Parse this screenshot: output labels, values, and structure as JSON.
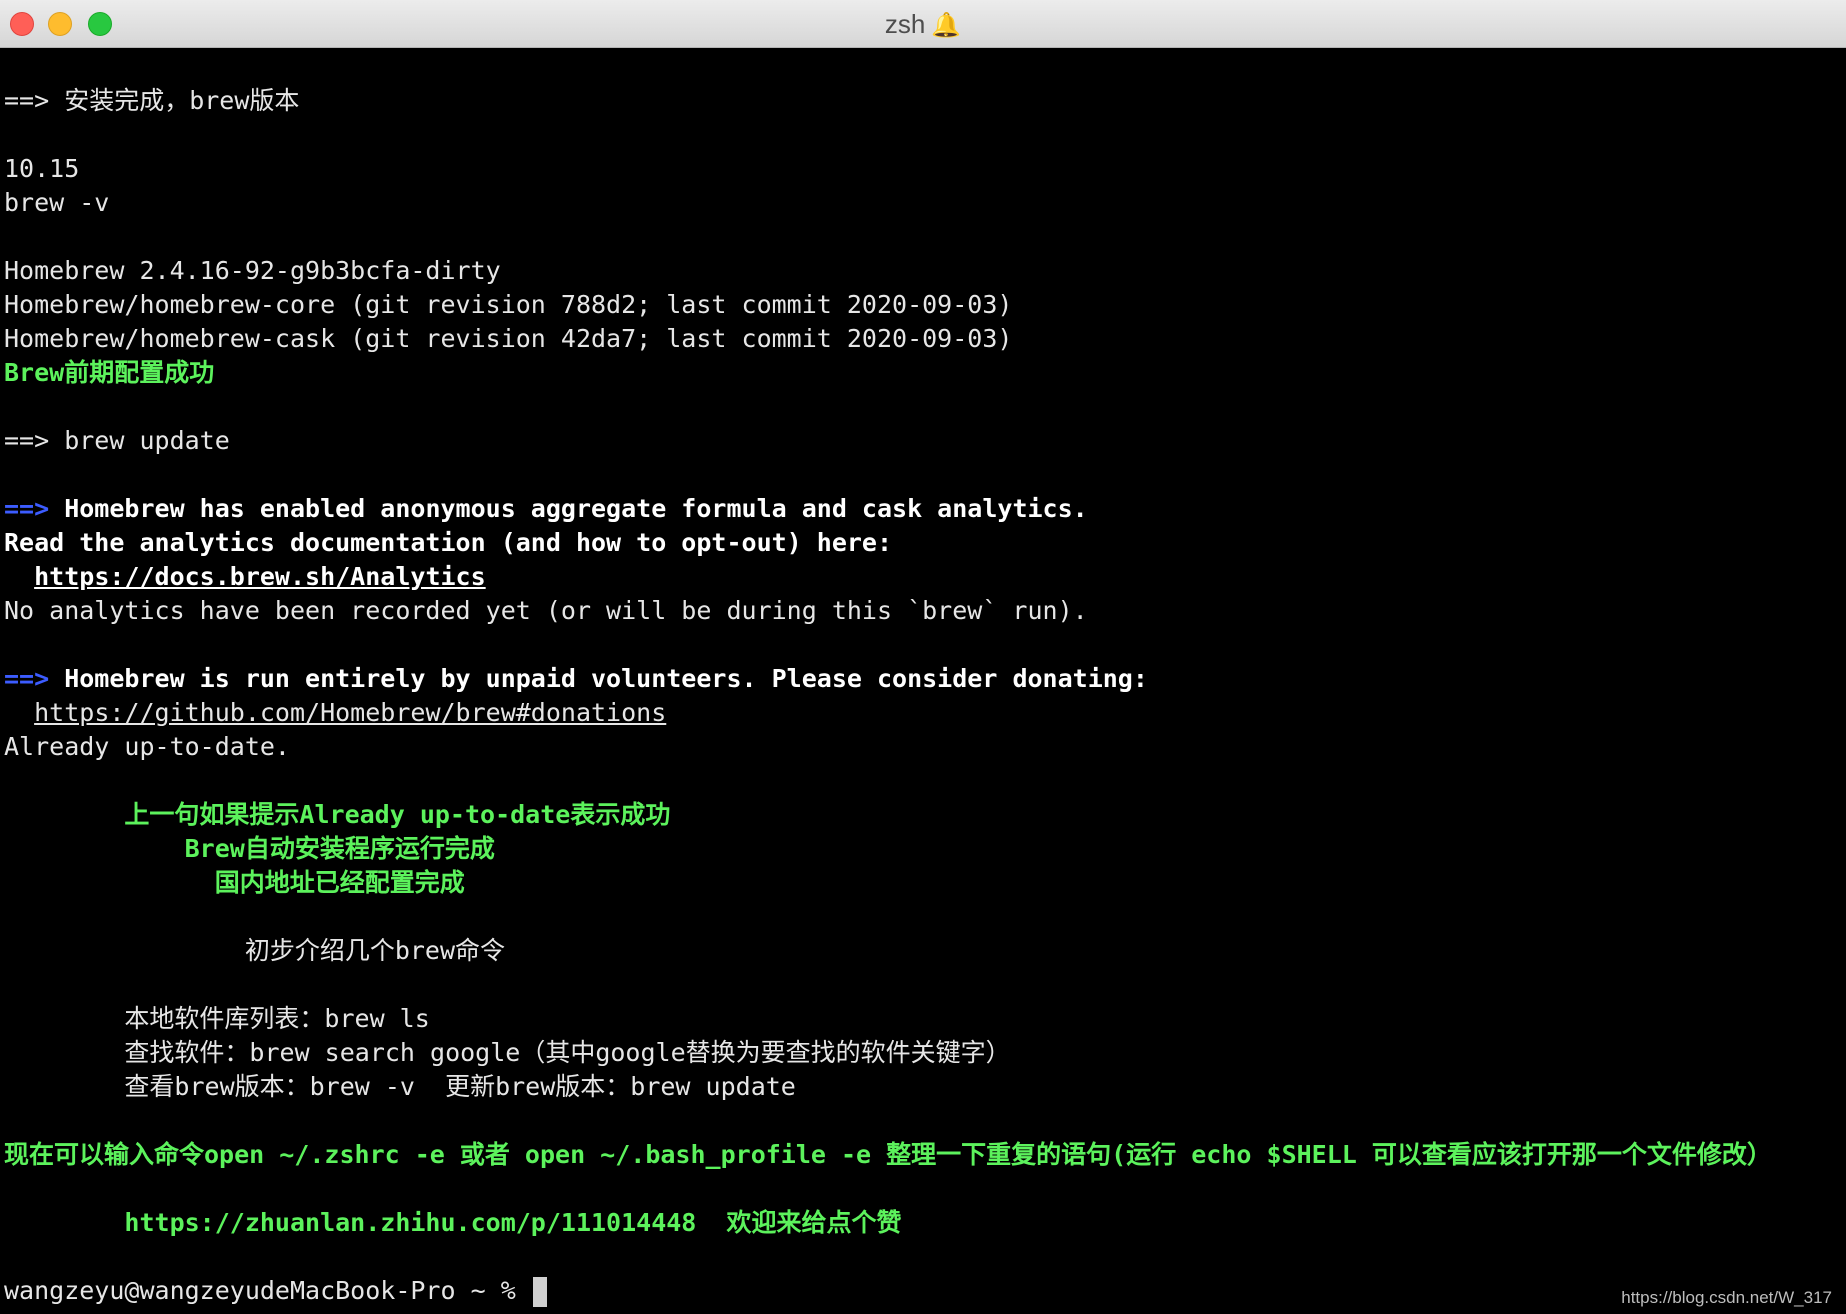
{
  "window": {
    "title": "zsh",
    "title_icon": "bell-icon",
    "controls": [
      "close",
      "minimize",
      "maximize"
    ],
    "colors": {
      "close": "#ff5f57",
      "minimize": "#febc2e",
      "maximize": "#28c840"
    }
  },
  "terminal": {
    "colors": {
      "default": "#e6e6e6",
      "green": "#5cf25c",
      "blue": "#3c5cff",
      "background": "#000000"
    },
    "l01": "==> 安装完成，brew版本",
    "l03": "10.15",
    "l04": "brew -v",
    "l06": "Homebrew 2.4.16-92-g9b3bcfa-dirty",
    "l07": "Homebrew/homebrew-core (git revision 788d2; last commit 2020-09-03)",
    "l08": "Homebrew/homebrew-cask (git revision 42da7; last commit 2020-09-03)",
    "l09": "Brew前期配置成功",
    "l11": "==> brew update",
    "l13_arrow": "==>",
    "l13_text": " Homebrew has enabled anonymous aggregate formula and cask analytics.",
    "l14": "Read the analytics documentation (and how to opt-out) here:",
    "l15_indent": "  ",
    "l15_link": "https://docs.brew.sh/Analytics",
    "l16": "No analytics have been recorded yet (or will be during this `brew` run).",
    "l18_arrow": "==>",
    "l18_text": " Homebrew is run entirely by unpaid volunteers. Please consider donating:",
    "l19_indent": "  ",
    "l19_link": "https://github.com/Homebrew/brew#donations",
    "l20": "Already up-to-date.",
    "l22": "        上一句如果提示Already up-to-date表示成功",
    "l23": "            Brew自动安装程序运行完成",
    "l24": "              国内地址已经配置完成",
    "l26": "                初步介绍几个brew命令",
    "l28": "        本地软件库列表：brew ls",
    "l29": "        查找软件：brew search google（其中google替换为要查找的软件关键字）",
    "l30": "        查看brew版本：brew -v  更新brew版本：brew update",
    "l32": "现在可以输入命令open ~/.zshrc -e 或者 open ~/.bash_profile -e 整理一下重复的语句(运行 echo $SHELL 可以查看应该打开那一个文件修改）",
    "l34": "        https://zhuanlan.zhihu.com/p/111014448  欢迎来给点个赞",
    "prompt": "wangzeyu@wangzeyudeMacBook-Pro ~ % "
  },
  "watermark": "https://blog.csdn.net/W_317"
}
